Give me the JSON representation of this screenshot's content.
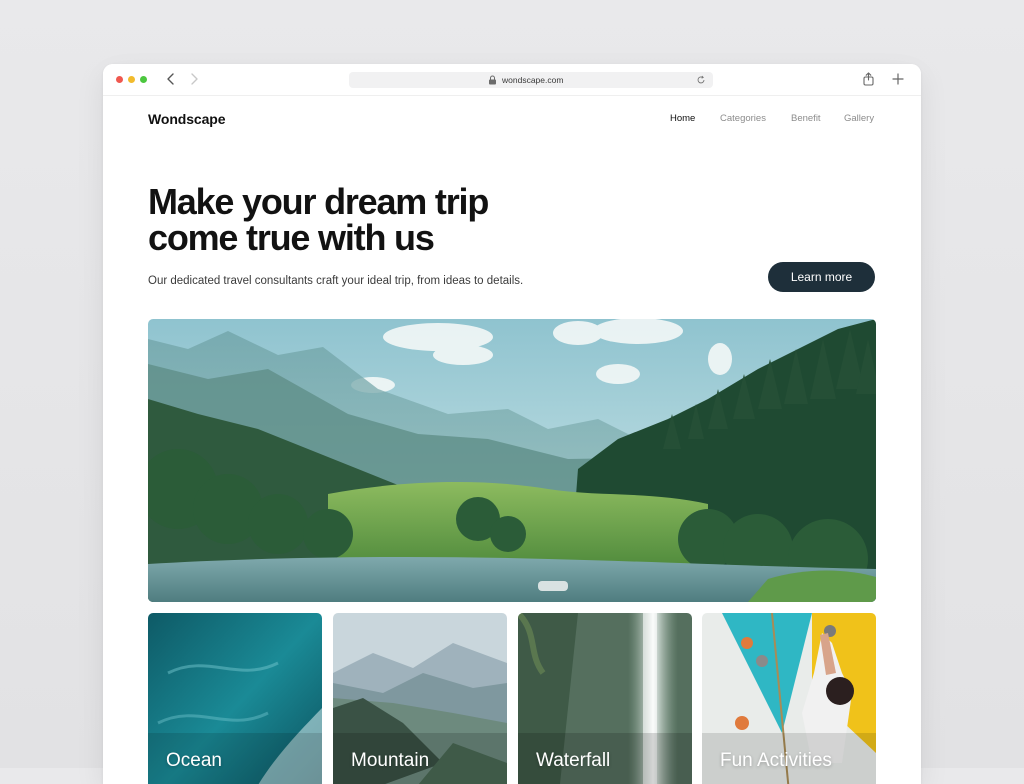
{
  "browser": {
    "url": "wondscape.com"
  },
  "site": {
    "logo": "Wondscape",
    "nav": [
      {
        "label": "Home",
        "active": true
      },
      {
        "label": "Categories",
        "active": false
      },
      {
        "label": "Benefit",
        "active": false
      },
      {
        "label": "Gallery",
        "active": false
      }
    ]
  },
  "hero": {
    "headline_line1": "Make your dream trip",
    "headline_line2": "come true with us",
    "subtext": "Our dedicated travel consultants craft your ideal trip, from ideas to details.",
    "cta_label": "Learn more"
  },
  "categories": [
    {
      "label": "Ocean"
    },
    {
      "label": "Mountain"
    },
    {
      "label": "Waterfall"
    },
    {
      "label": "Fun Activities"
    }
  ],
  "colors": {
    "cta_background": "#1e2f3a",
    "nav_active": "#111111",
    "nav_inactive": "#8c8c8c"
  }
}
